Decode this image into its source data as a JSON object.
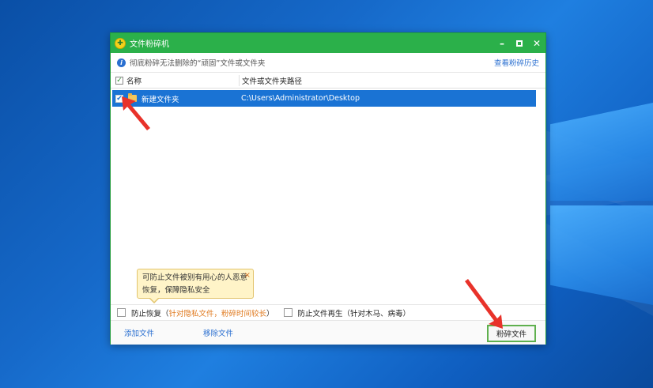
{
  "window": {
    "title": "文件粉碎机",
    "controls": [
      "minimize-icon",
      "maximize-icon",
      "close-icon"
    ]
  },
  "info": {
    "text": "彻底粉碎无法删除的“顽固”文件或文件夹",
    "history_link": "查看粉碎历史"
  },
  "table": {
    "columns": [
      "名称",
      "文件或文件夹路径"
    ],
    "rows": [
      {
        "name": "新建文件夹",
        "path": "C:\\Users\\Administrator\\Desktop",
        "checked": true,
        "selected": true
      }
    ]
  },
  "tooltip": {
    "line1": "可防止文件被别有用心的人恶意",
    "line2": "恢复，保障隐私安全",
    "close": "×"
  },
  "options": {
    "prevent_recovery_label": "防止恢复（",
    "prevent_recovery_note": "针对隐私文件，粉碎时间较长",
    "prevent_recovery_close": "）",
    "prevent_regen_label": "防止文件再生（针对木马、病毒）"
  },
  "bottom": {
    "add_file": "添加文件",
    "remove_file": "移除文件",
    "shred_button": "粉碎文件"
  },
  "colors": {
    "titlebar": "#2bb04a",
    "selection": "#1a73d4",
    "link": "#2a6fd0",
    "arrow": "#e8322a"
  }
}
